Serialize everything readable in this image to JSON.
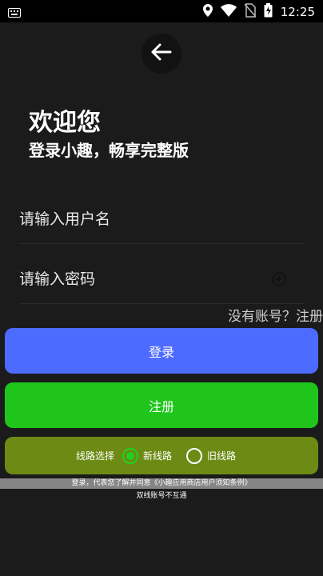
{
  "status_bar": {
    "time": "12:25",
    "icons": [
      "keyboard-icon",
      "location-icon",
      "wifi-icon",
      "no-sim-icon",
      "battery-charging-icon"
    ]
  },
  "header": {
    "back_icon": "arrow-left-icon"
  },
  "welcome": {
    "title": "欢迎您",
    "subtitle": "登录小趣，畅享完整版"
  },
  "form": {
    "username_placeholder": "请输入用户名",
    "password_placeholder": "请输入密码",
    "password_toggle_icon": "plus-circle-icon",
    "register_link": "没有账号？注册"
  },
  "buttons": {
    "login": "登录",
    "register": "注册"
  },
  "route": {
    "label": "线路选择",
    "options": [
      {
        "label": "新线路",
        "selected": true
      },
      {
        "label": "旧线路",
        "selected": false
      }
    ]
  },
  "footer": {
    "agreement": "登录，代表您了解并同意《小趣应用商店用户须知条例》",
    "note": "双线账号不互通"
  },
  "colors": {
    "login_button": "#4e6bff",
    "register_button": "#1fc51b",
    "route_box": "#6c8a14",
    "background": "#1b1b1b"
  }
}
